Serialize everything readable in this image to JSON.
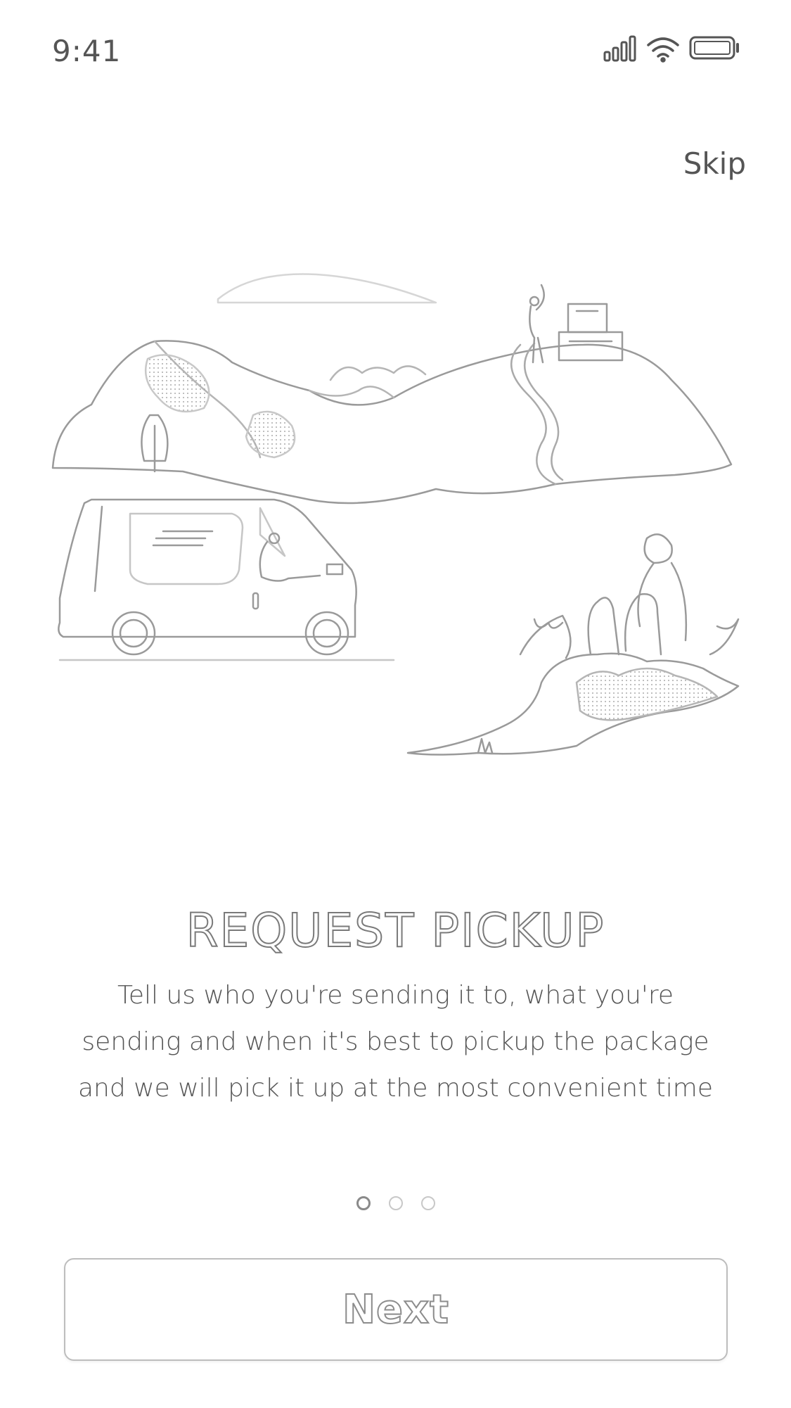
{
  "status_bar": {
    "time": "9:41",
    "icons": [
      "signal-icon",
      "wifi-icon",
      "battery-icon"
    ]
  },
  "header": {
    "skip_label": "Skip"
  },
  "illustration": {
    "icon": "delivery-van-landscape-illustration"
  },
  "content": {
    "title": "REQUEST PICKUP",
    "description_lines": [
      "Tell us who you're sending it to, what you're",
      "sending and when it's best to pickup the package",
      "and we will pick it up at the most convenient time"
    ]
  },
  "pagination": {
    "total": 3,
    "current": 1
  },
  "footer": {
    "next_label": "Next"
  }
}
